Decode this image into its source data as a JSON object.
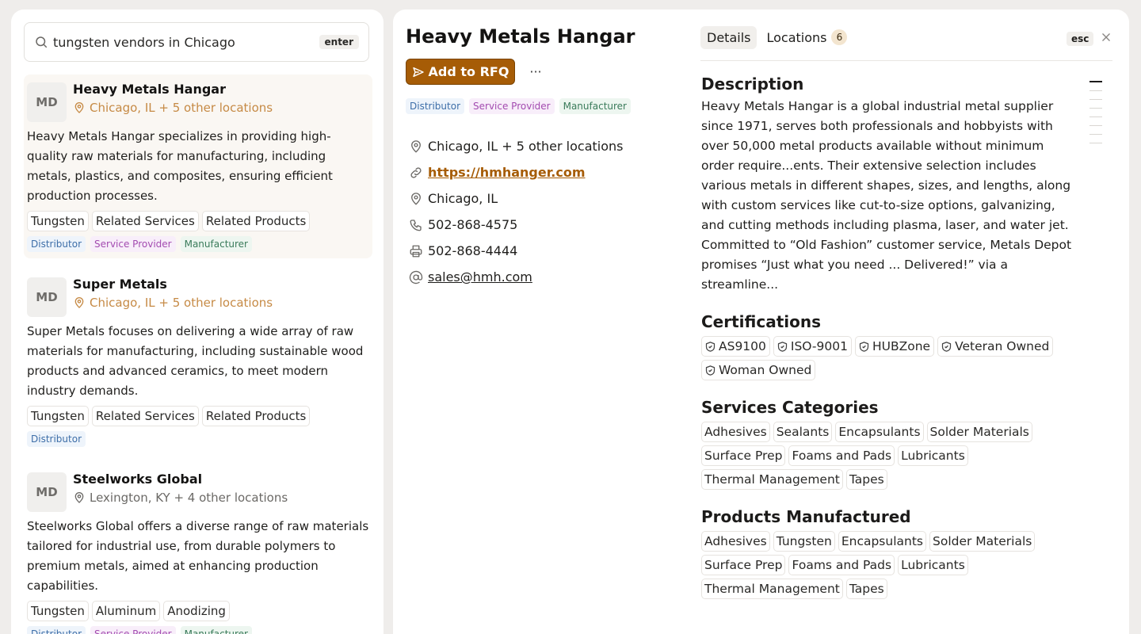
{
  "search": {
    "value": "tungsten vendors in Chicago",
    "enter_key": "enter"
  },
  "results": [
    {
      "initials": "MD",
      "name": "Heavy Metals Hangar",
      "location": "Chicago, IL + 5 other locations",
      "description": "Heavy Metals Hangar specializes in providing high-quality raw materials for manufacturing, including metals, plastics, and composites, ensuring efficient production processes.",
      "tags": [
        "Tungsten",
        "Related Services",
        "Related Products"
      ],
      "roles": [
        "Distributor",
        "Service Provider",
        "Manufacturer"
      ]
    },
    {
      "initials": "MD",
      "name": "Super Metals",
      "location": "Chicago, IL + 5 other locations",
      "description": "Super Metals focuses on delivering a wide array of raw materials for manufacturing, including sustainable wood products and advanced ceramics, to meet modern industry demands.",
      "tags": [
        "Tungsten",
        "Related Services",
        "Related Products"
      ],
      "roles": [
        "Distributor"
      ]
    },
    {
      "initials": "MD",
      "name": "Steelworks Global",
      "location": "Lexington, KY + 4 other locations",
      "description": "Steelworks Global offers a diverse range of raw materials tailored for industrial use, from durable polymers to premium metals, aimed at enhancing production capabilities.",
      "tags": [
        "Tungsten",
        "Aluminum",
        "Anodizing"
      ],
      "roles": [
        "Distributor",
        "Service Provider",
        "Manufacturer"
      ]
    }
  ],
  "detail": {
    "name": "Heavy Metals Hangar",
    "rfq_label": "Add to RFQ",
    "more_label": "···",
    "roles": [
      "Distributor",
      "Service Provider",
      "Manufacturer"
    ],
    "locations_summary": "Chicago, IL + 5 other locations",
    "website": "https://hmhanger.com",
    "city": "Chicago, IL",
    "phone": "502-868-4575",
    "fax": "502-868-4444",
    "email": "sales@hmh.com",
    "tabs": {
      "details": "Details",
      "locations": "Locations",
      "locations_count": "6"
    },
    "esc_key": "esc",
    "description_heading": "Description",
    "description": "Heavy Metals Hangar is a global industrial metal supplier since 1971, serves both professionals and hobbyists with over 50,000 metal products available without minimum order require...ents. Their extensive selection includes various metals in different shapes, sizes, and lengths, along with custom services like cut-to-size options, galvanizing, and cutting methods including plasma, laser, and water jet. Committed to “Old Fashion” customer service, Metals Depot promises “Just what you need ... Delivered!” via a streamline...",
    "certifications_heading": "Certifications",
    "certifications": [
      "AS9100",
      "ISO-9001",
      "HUBZone",
      "Veteran Owned",
      "Woman Owned"
    ],
    "services_heading": "Services Categories",
    "services": [
      "Adhesives",
      "Sealants",
      "Encapsulants",
      "Solder Materials",
      "Surface Prep",
      "Foams and Pads",
      "Lubricants",
      "Thermal Management",
      "Tapes"
    ],
    "products_heading": "Products Manufactured",
    "products": [
      "Adhesives",
      "Tungsten",
      "Encapsulants",
      "Solder Materials",
      "Surface Prep",
      "Foams and Pads",
      "Lubricants",
      "Thermal Management",
      "Tapes"
    ]
  },
  "colors": {
    "accent": "#a65c06",
    "location_highlight": "#c68a45",
    "distributor": "#3d6ea8",
    "service_provider": "#a34bb0",
    "manufacturer": "#3a7b5a"
  }
}
